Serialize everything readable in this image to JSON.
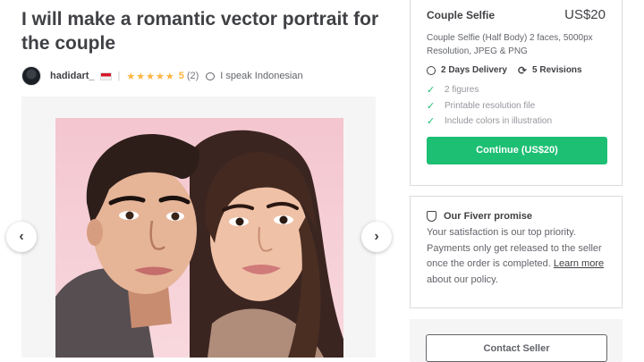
{
  "gig": {
    "title": "I will make a romantic vector portrait for the couple"
  },
  "seller": {
    "name": "hadidart_",
    "stars": "★★★★★",
    "rating": "5",
    "reviews": "(2)",
    "language": "I speak Indonesian",
    "flag_colors": [
      "#d7182a",
      "#f3f3f3"
    ]
  },
  "gallery": {
    "prev": "‹",
    "next": "›",
    "image_alt": "couple vector portrait"
  },
  "package": {
    "name": "Couple Selfie",
    "price": "US$20",
    "description": "Couple Selfie (Half Body) 2 faces, 5000px Resolution, JPEG & PNG",
    "delivery": "2 Days Delivery",
    "revisions": "5 Revisions",
    "features": [
      "2 figures",
      "Printable resolution file",
      "Include colors in illustration"
    ],
    "cta": "Continue (US$20)"
  },
  "promise": {
    "title": "Our Fiverr promise",
    "text_before": "Your satisfaction is our top priority. Payments only get released to the seller once the order is completed. ",
    "link": "Learn more",
    "text_after": " about our policy."
  },
  "contact": {
    "label": "Contact Seller"
  },
  "colors": {
    "accent": "#1dbf73",
    "star": "#ffb33e",
    "text": "#404145"
  }
}
